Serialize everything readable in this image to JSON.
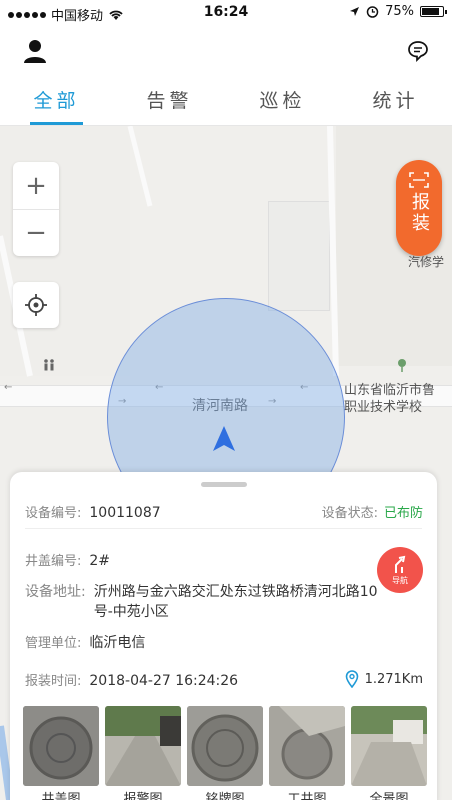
{
  "status_bar": {
    "carrier": "中国移动",
    "time": "16:24",
    "battery": "75%",
    "battery_level": 0.75
  },
  "tabs": [
    {
      "label": "全部",
      "active": true
    },
    {
      "label": "告警",
      "active": false
    },
    {
      "label": "巡检",
      "active": false
    },
    {
      "label": "统计",
      "active": false
    }
  ],
  "map": {
    "road_name": "清河南路",
    "poi_school": [
      "山东省临沂市鲁",
      "职业技术学校"
    ],
    "poi_edge": [
      "新汽",
      "汽修学"
    ],
    "zoom_in": "+",
    "zoom_out": "−",
    "report_button": "报装"
  },
  "device": {
    "id_label": "设备编号:",
    "id_value": "10011087",
    "status_label": "设备状态:",
    "status_value": "已布防",
    "cover_label": "井盖编号:",
    "cover_value": "2#",
    "address_label": "设备地址:",
    "address_value": "沂州路与金六路交汇处东过铁路桥清河北路10号-中苑小区",
    "unit_label": "管理单位:",
    "unit_value": "临沂电信",
    "time_label": "报装时间:",
    "time_value": "2018-04-27 16:24:26",
    "distance": "1.271Km",
    "nav_label": "导航"
  },
  "photos": [
    "井盖图",
    "报警图",
    "铭牌图",
    "工井图",
    "全景图"
  ],
  "colors": {
    "accent": "#1f9ad6",
    "report": "#f26a2d",
    "nav": "#f2534b",
    "armed": "#2aa84a"
  }
}
